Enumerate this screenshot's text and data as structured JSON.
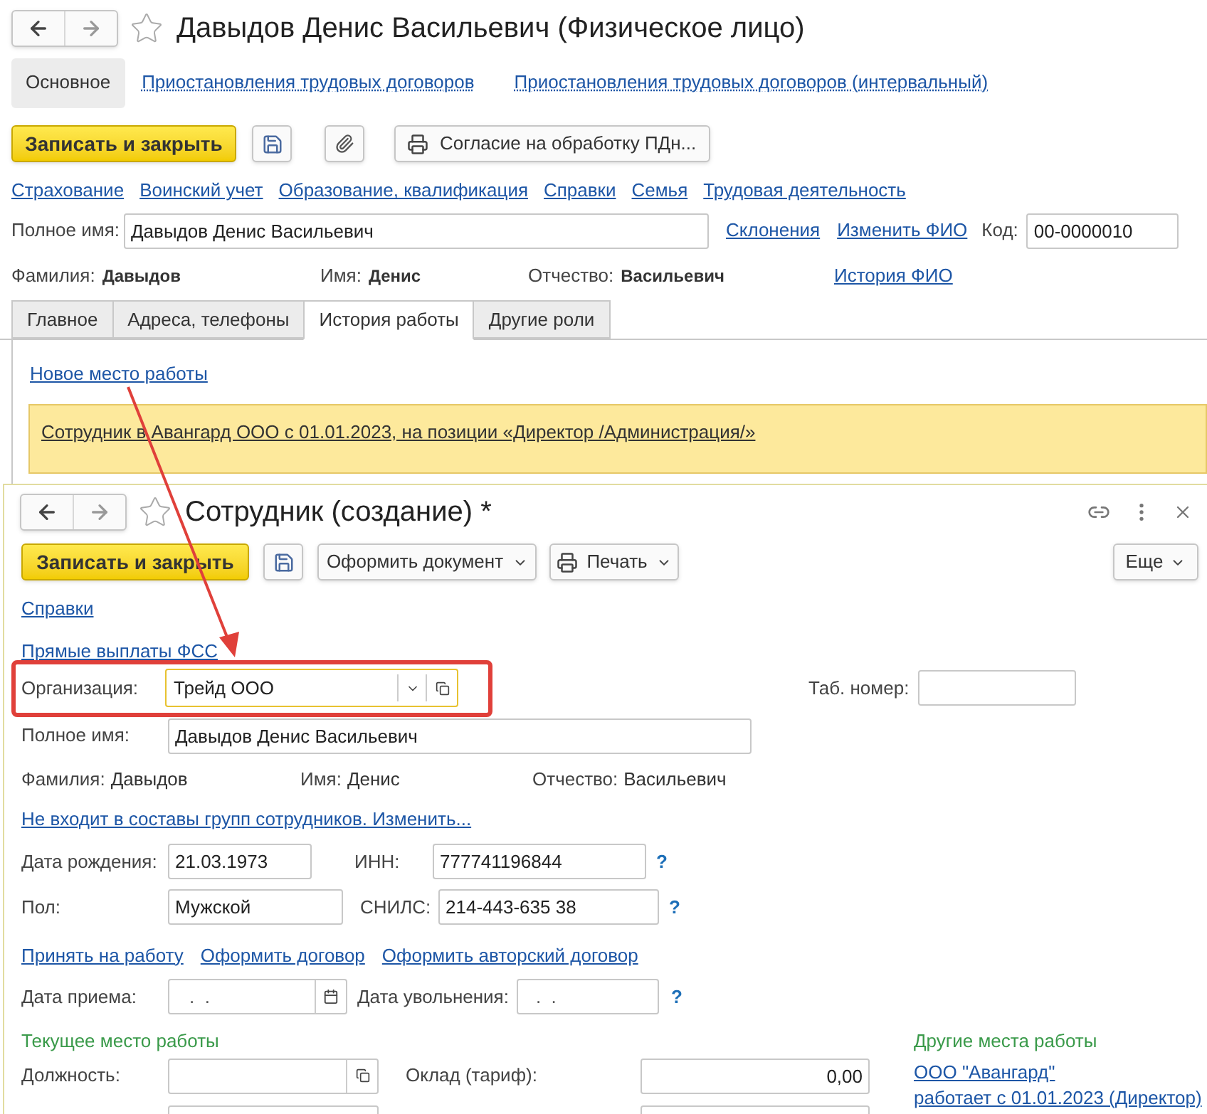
{
  "back_window": {
    "title": "Давыдов Денис Васильевич (Физическое лицо)",
    "sections": [
      {
        "label": "Основное",
        "selected": true
      },
      {
        "label": "Приостановления трудовых договоров",
        "selected": false
      },
      {
        "label": "Приостановления трудовых договоров (интервальный)",
        "selected": false
      }
    ],
    "save_close": "Записать и закрыть",
    "print_button": "Согласие на обработку ПДн...",
    "links": [
      "Страхование",
      "Воинский учет",
      "Образование, квалификация",
      "Справки",
      "Семья",
      "Трудовая деятельность"
    ],
    "full_name": {
      "label": "Полное имя:",
      "value": "Давыдов Денис Васильевич"
    },
    "name_links": [
      "Склонения",
      "Изменить ФИО"
    ],
    "code": {
      "label": "Код:",
      "value": "00-0000010"
    },
    "fio": [
      {
        "label": "Фамилия:",
        "value": "Давыдов"
      },
      {
        "label": "Имя:",
        "value": "Денис"
      },
      {
        "label": "Отчество:",
        "value": "Васильевич"
      }
    ],
    "history_link": "История ФИО",
    "tabs": [
      {
        "label": "Главное",
        "selected": false
      },
      {
        "label": "Адреса, телефоны",
        "selected": false
      },
      {
        "label": "История работы",
        "selected": true
      },
      {
        "label": "Другие роли",
        "selected": false
      }
    ],
    "new_job_link": "Новое место работы",
    "job_entry": "Сотрудник в Авангард ООО с 01.01.2023, на позиции «Директор /Администрация/»"
  },
  "front_window": {
    "title": "Сотрудник (создание) *",
    "save_close": "Записать и закрыть",
    "document_button": "Оформить документ",
    "print_button": "Печать",
    "more_button": "Еще",
    "links": [
      "Справки",
      "Прямые выплаты ФСС"
    ],
    "organization": {
      "label": "Организация:",
      "value": "Трейд ООО"
    },
    "tab_number": {
      "label": "Таб. номер:"
    },
    "full_name": {
      "label": "Полное имя:",
      "value": "Давыдов Денис Васильевич"
    },
    "fio": [
      {
        "label": "Фамилия:",
        "value": "Давыдов"
      },
      {
        "label": "Имя:",
        "value": "Денис"
      },
      {
        "label": "Отчество:",
        "value": "Васильевич"
      }
    ],
    "group_link": "Не входит в составы групп сотрудников. Изменить...",
    "birth_date": {
      "label": "Дата рождения:",
      "value": "21.03.1973"
    },
    "inn": {
      "label": "ИНН:",
      "value": "777741196844"
    },
    "gender": {
      "label": "Пол:",
      "value": "Мужской"
    },
    "snils": {
      "label": "СНИЛС:",
      "value": "214-443-635 38"
    },
    "help_marks": [
      "?",
      "?",
      "?"
    ],
    "hire_links": [
      "Принять на работу",
      "Оформить договор",
      "Оформить авторский договор"
    ],
    "hire_date": {
      "label": "Дата приема:",
      "value": ".  ."
    },
    "dismissal_date": {
      "label": "Дата увольнения:",
      "value": ".  ."
    },
    "current_job_title": "Текущее место работы",
    "position": {
      "label": "Должность:"
    },
    "salary": {
      "label": "Оклад (тариф):",
      "value": "0,00"
    },
    "other_jobs_title": "Другие места работы",
    "other_jobs": [
      "ООО \"Авангард\"",
      "работает с 01.01.2023 (Директор)"
    ]
  }
}
